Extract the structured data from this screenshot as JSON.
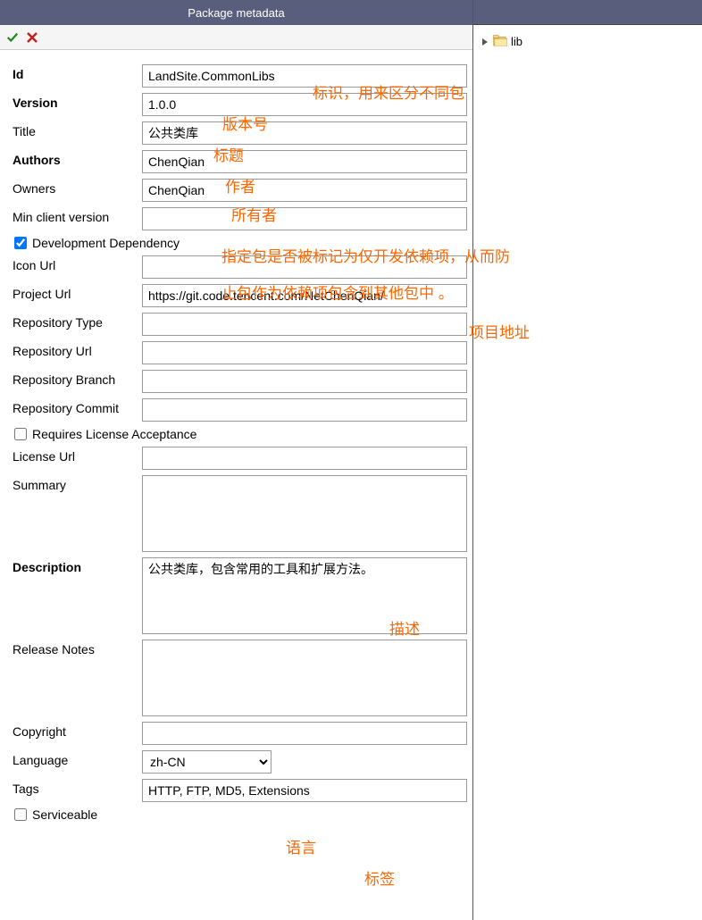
{
  "header": {
    "title": "Package metadata"
  },
  "form": {
    "id": {
      "label": "Id",
      "value": "LandSite.CommonLibs"
    },
    "version": {
      "label": "Version",
      "value": "1.0.0"
    },
    "title": {
      "label": "Title",
      "value": "公共类库"
    },
    "authors": {
      "label": "Authors",
      "value": "ChenQian"
    },
    "owners": {
      "label": "Owners",
      "value": "ChenQian"
    },
    "min_client": {
      "label": "Min client version",
      "value": ""
    },
    "dev_dep": {
      "label": "Development Dependency",
      "checked": true
    },
    "icon_url": {
      "label": "Icon Url",
      "value": ""
    },
    "project_url": {
      "label": "Project Url",
      "value": "https://git.code.tencent.com/NetChenQian/"
    },
    "repo_type": {
      "label": "Repository Type",
      "value": ""
    },
    "repo_url": {
      "label": "Repository Url",
      "value": ""
    },
    "repo_branch": {
      "label": "Repository Branch",
      "value": ""
    },
    "repo_commit": {
      "label": "Repository Commit",
      "value": ""
    },
    "req_license": {
      "label": "Requires License Acceptance",
      "checked": false
    },
    "license_url": {
      "label": "License Url",
      "value": ""
    },
    "summary": {
      "label": "Summary",
      "value": ""
    },
    "description": {
      "label": "Description",
      "value": "公共类库，包含常用的工具和扩展方法。"
    },
    "release_notes": {
      "label": "Release Notes",
      "value": ""
    },
    "copyright": {
      "label": "Copyright",
      "value": ""
    },
    "language": {
      "label": "Language",
      "value": "zh-CN"
    },
    "tags": {
      "label": "Tags",
      "value": "HTTP, FTP, MD5, Extensions"
    },
    "serviceable": {
      "label": "Serviceable",
      "checked": false
    }
  },
  "tree": {
    "root": "lib"
  },
  "annotations": {
    "id": "标识，用来区分不同包",
    "version": "版本号",
    "title": "标题",
    "authors": "作者",
    "owners": "所有者",
    "dev_dep_line1": "指定包是否被标记为仅开发依赖项，从而防",
    "dev_dep_line2": "止包作为依赖项包含到其他包中 。",
    "project_url": "项目地址",
    "description": "描述",
    "language": "语言",
    "tags": "标签"
  }
}
